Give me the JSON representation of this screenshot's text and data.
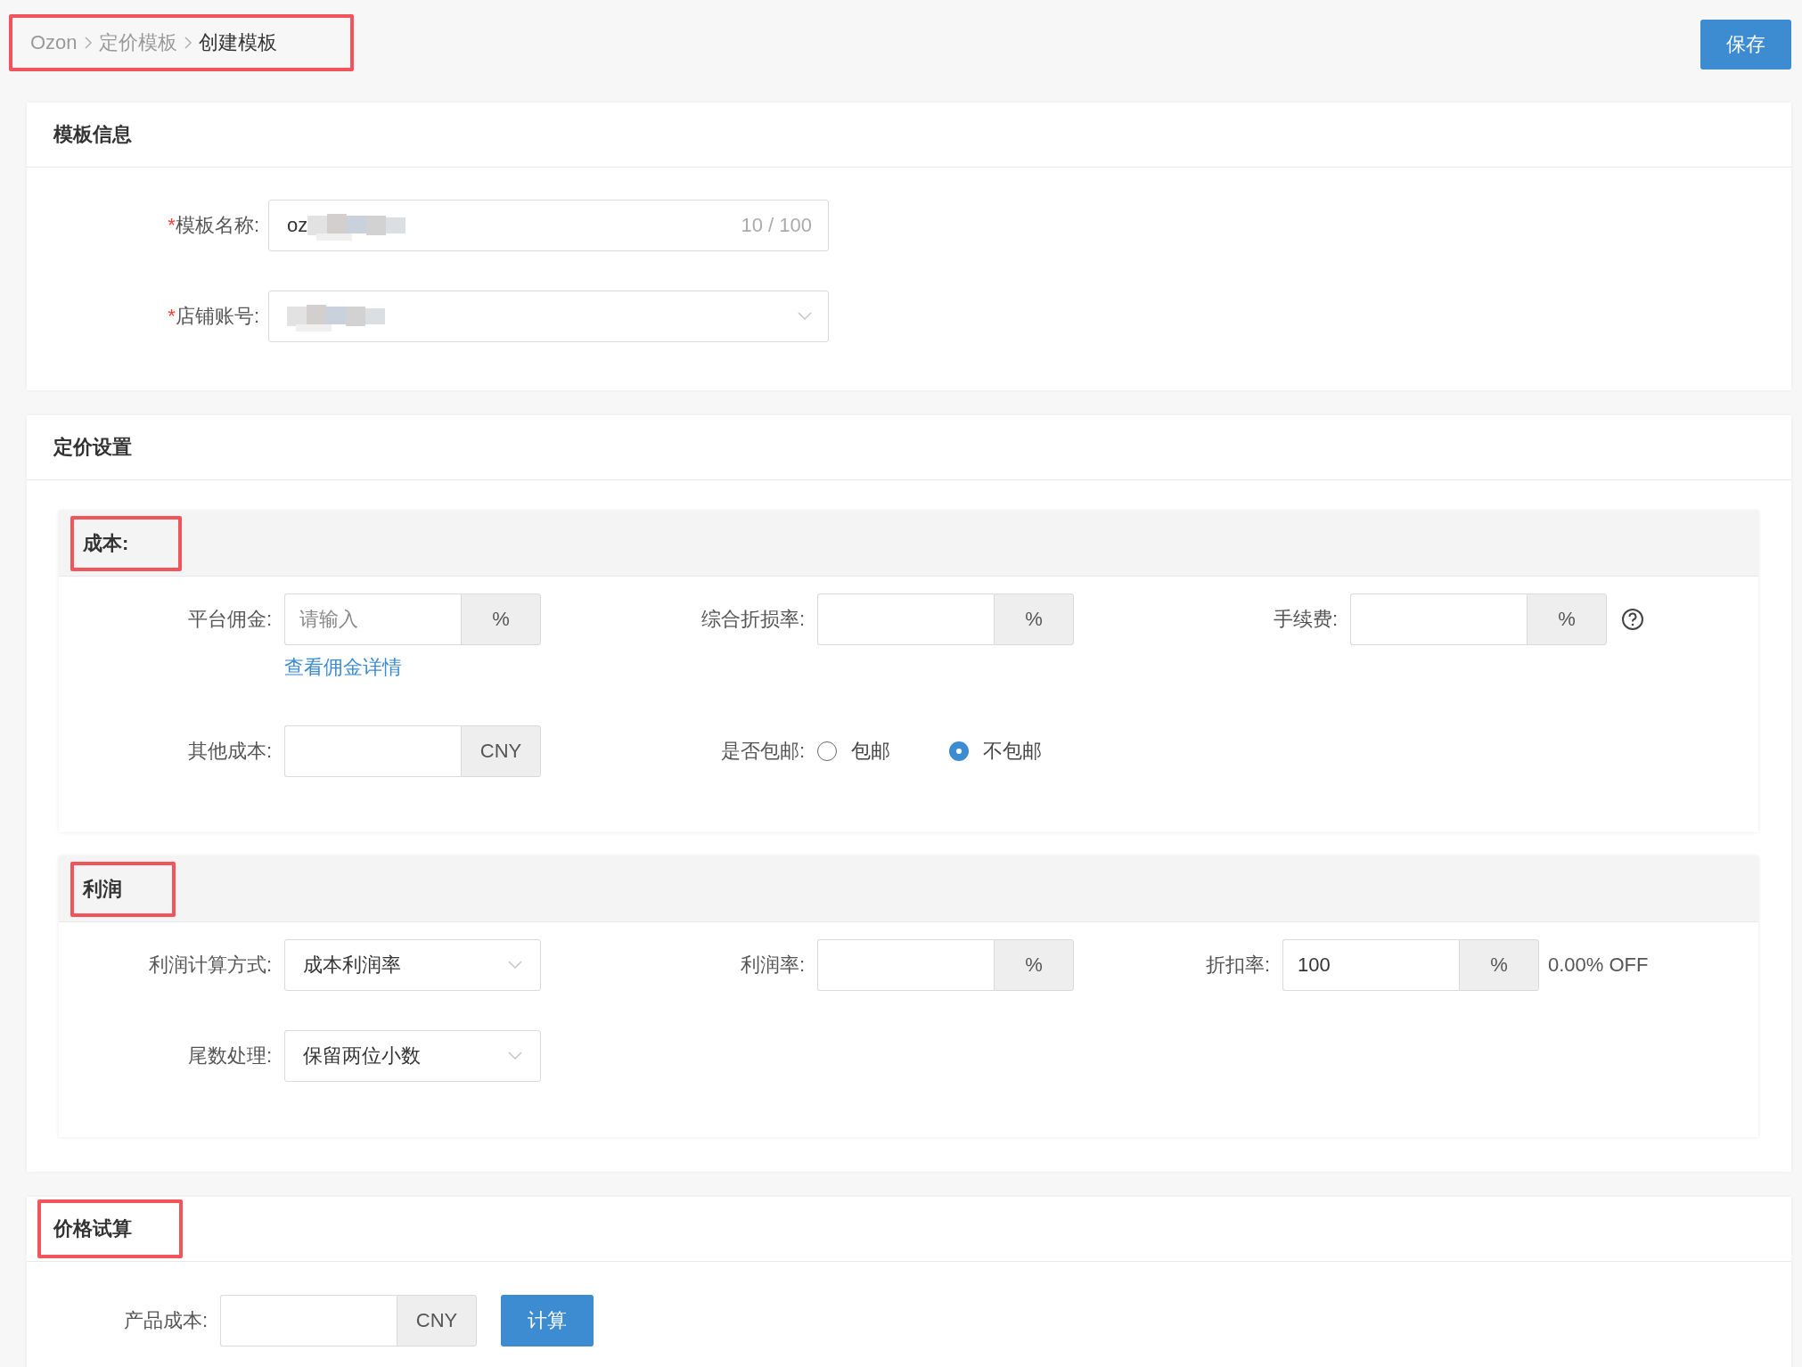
{
  "breadcrumb": {
    "highlighted": true,
    "items": [
      {
        "label": "Ozon",
        "current": false
      },
      {
        "label": "定价模板",
        "current": false
      },
      {
        "label": "创建模板",
        "current": true
      }
    ]
  },
  "save_button": "保存",
  "template_info": {
    "title": "模板信息",
    "highlighted": false,
    "fields": [
      {
        "kind": "text",
        "required_mark": "*",
        "label": "模板名称:",
        "value": "oz",
        "counter": "10 / 100",
        "redacted": true
      },
      {
        "kind": "select",
        "required_mark": "*",
        "label": "店铺账号:",
        "redacted": true
      }
    ]
  },
  "pricing": {
    "title": "定价设置",
    "highlighted": false,
    "groups": [
      {
        "title": "成本:",
        "highlighted": true,
        "rows": [
          [
            {
              "kind": "addon",
              "label": "平台佣金:",
              "placeholder": "请输入",
              "addon": "%",
              "link": "查看佣金详情"
            },
            {
              "kind": "addon",
              "label": "综合折损率:",
              "addon": "%"
            },
            {
              "kind": "addon",
              "label": "手续费:",
              "addon": "%",
              "help": true
            }
          ],
          [
            {
              "kind": "addon",
              "label": "其他成本:",
              "addon": "CNY"
            },
            {
              "kind": "radio",
              "label": "是否包邮:",
              "options": [
                {
                  "label": "包邮",
                  "selected": false
                },
                {
                  "label": "不包邮",
                  "selected": true
                }
              ]
            }
          ]
        ]
      },
      {
        "title": "利润",
        "highlighted": true,
        "rows": [
          [
            {
              "kind": "select",
              "label": "利润计算方式:",
              "value": "成本利润率"
            },
            {
              "kind": "addon",
              "label": "利润率:",
              "addon": "%"
            },
            {
              "kind": "addon",
              "label": "折扣率:",
              "value": "100",
              "addon": "%",
              "note": "0.00% OFF"
            }
          ],
          [
            {
              "kind": "select",
              "label": "尾数处理:",
              "value": "保留两位小数"
            }
          ]
        ]
      }
    ]
  },
  "trial": {
    "title": "价格试算",
    "highlighted": true,
    "field": {
      "kind": "addon",
      "label": "产品成本:",
      "addon": "CNY"
    },
    "button": "计算"
  }
}
